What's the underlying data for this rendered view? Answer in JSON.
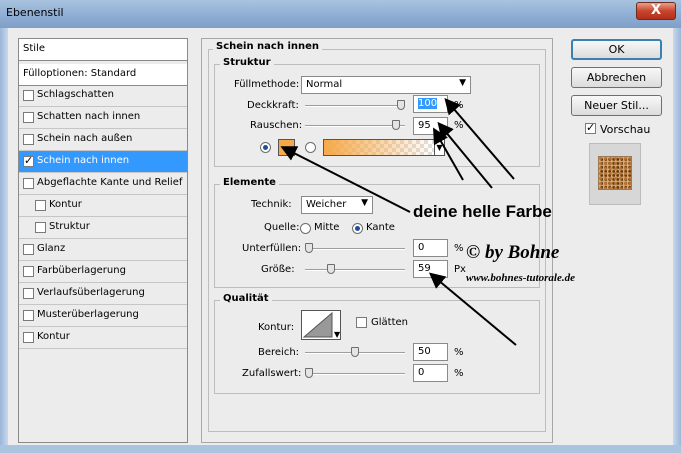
{
  "window": {
    "title": "Ebenenstil",
    "close_label": "X"
  },
  "sidebar": {
    "header": "Stile",
    "blend_options": "Fülloptionen: Standard",
    "items": [
      {
        "label": "Schlagschatten",
        "checked": false,
        "indent": false
      },
      {
        "label": "Schatten nach innen",
        "checked": false,
        "indent": false
      },
      {
        "label": "Schein nach außen",
        "checked": false,
        "indent": false
      },
      {
        "label": "Schein nach innen",
        "checked": true,
        "indent": false,
        "selected": true
      },
      {
        "label": "Abgeflachte Kante und Relief",
        "checked": false,
        "indent": false
      },
      {
        "label": "Kontur",
        "checked": false,
        "indent": true
      },
      {
        "label": "Struktur",
        "checked": false,
        "indent": true
      },
      {
        "label": "Glanz",
        "checked": false,
        "indent": false
      },
      {
        "label": "Farbüberlagerung",
        "checked": false,
        "indent": false
      },
      {
        "label": "Verlaufsüberlagerung",
        "checked": false,
        "indent": false
      },
      {
        "label": "Musterüberlagerung",
        "checked": false,
        "indent": false
      },
      {
        "label": "Kontur",
        "checked": false,
        "indent": false
      }
    ]
  },
  "panel": {
    "title": "Schein nach innen",
    "struktur": {
      "legend": "Struktur",
      "blend_mode_label": "Füllmethode:",
      "blend_mode_value": "Normal",
      "opacity_label": "Deckkraft:",
      "opacity_value": "100",
      "opacity_unit": "%",
      "opacity_fraction": 1.0,
      "noise_label": "Rauschen:",
      "noise_value": "95",
      "noise_unit": "%",
      "noise_fraction": 0.95,
      "color_radio_selected": true,
      "gradient_radio_selected": false,
      "swatch_color": "#f5a94a"
    },
    "elemente": {
      "legend": "Elemente",
      "technique_label": "Technik:",
      "technique_value": "Weicher",
      "source_label": "Quelle:",
      "source_center": "Mitte",
      "source_edge": "Kante",
      "source_selected": "Kante",
      "choke_label": "Unterfüllen:",
      "choke_value": "0",
      "choke_unit": "%",
      "choke_fraction": 0.0,
      "size_label": "Größe:",
      "size_value": "59",
      "size_unit": "Px",
      "size_fraction": 0.24
    },
    "qualitaet": {
      "legend": "Qualität",
      "contour_label": "Kontur:",
      "antialias_label": "Glätten",
      "antialias_checked": false,
      "range_label": "Bereich:",
      "range_value": "50",
      "range_unit": "%",
      "range_fraction": 0.5,
      "jitter_label": "Zufallswert:",
      "jitter_value": "0",
      "jitter_unit": "%",
      "jitter_fraction": 0.0
    }
  },
  "buttons": {
    "ok": "OK",
    "cancel": "Abbrechen",
    "new_style": "Neuer Stil...",
    "preview_label": "Vorschau",
    "preview_checked": true
  },
  "annotations": {
    "color_note": "deine helle Farbe",
    "copyright": "© by Bohne",
    "url": "www.bohnes-tutorale.de"
  },
  "colors": {
    "selection": "#3399ff",
    "accent_swatch": "#f5a94a"
  }
}
